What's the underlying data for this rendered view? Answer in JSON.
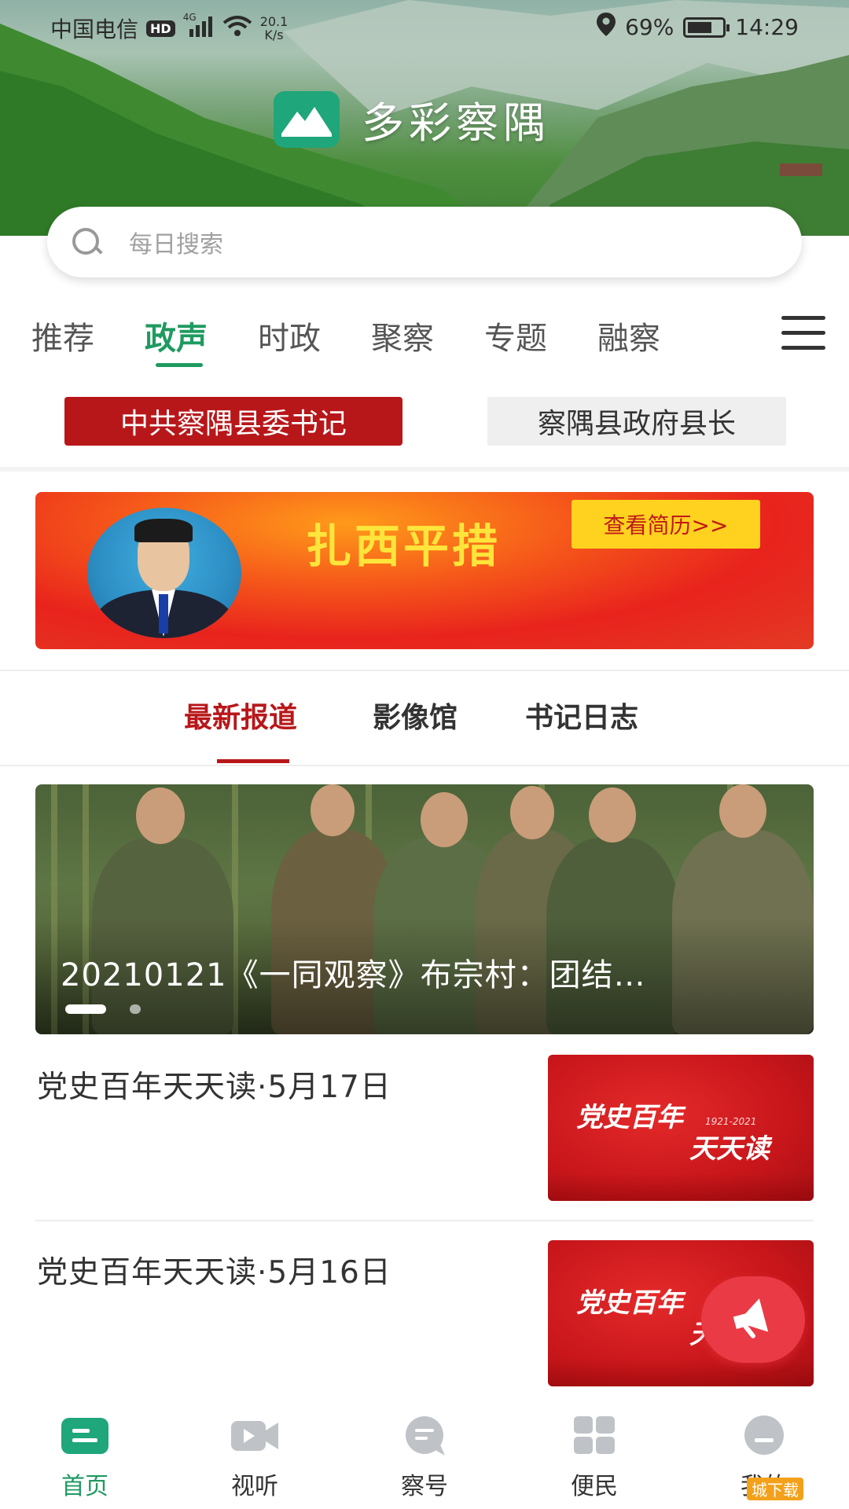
{
  "status_bar": {
    "carrier": "中国电信",
    "hd": "HD",
    "net_type": "4G",
    "speed_value": "20.1",
    "speed_unit": "K/s",
    "battery_pct": "69%",
    "time": "14:29"
  },
  "app": {
    "name": "多彩察隅"
  },
  "search": {
    "placeholder": "每日搜索"
  },
  "tabs": [
    {
      "label": "推荐"
    },
    {
      "label": "政声"
    },
    {
      "label": "时政"
    },
    {
      "label": "聚察"
    },
    {
      "label": "专题"
    },
    {
      "label": "融察"
    }
  ],
  "leaders": {
    "active": "中共察隅县委书记",
    "inactive": "察隅县政府县长"
  },
  "banner": {
    "name": "扎西平措",
    "button": "查看简历>>"
  },
  "subtabs": [
    {
      "label": "最新报道"
    },
    {
      "label": "影像馆"
    },
    {
      "label": "书记日志"
    }
  ],
  "carousel": {
    "caption": "20210121《一同观察》布宗村：团结…"
  },
  "news": [
    {
      "title": "党史百年天天读·5月17日",
      "thumb_line1": "党史百年",
      "thumb_line2": "天天读",
      "thumb_year": "1921-2021"
    },
    {
      "title": "党史百年天天读·5月16日",
      "thumb_line1": "党史百年",
      "thumb_line2": "天"
    }
  ],
  "bottom_nav": [
    {
      "label": "首页"
    },
    {
      "label": "视听"
    },
    {
      "label": "察号"
    },
    {
      "label": "便民"
    },
    {
      "label": "我的"
    }
  ],
  "watermark": "城下载",
  "colors": {
    "accent_green": "#1f9a60",
    "accent_red": "#b8171a",
    "banner_name_yellow": "#ffe53b"
  }
}
